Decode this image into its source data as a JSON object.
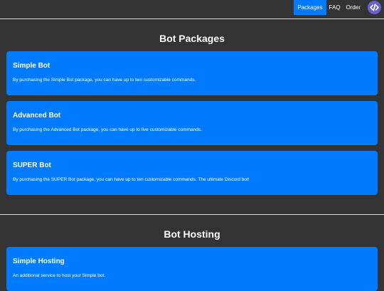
{
  "nav": {
    "links": [
      {
        "label": "Packages",
        "active": true
      },
      {
        "label": "FAQ",
        "active": false
      },
      {
        "label": "Order",
        "active": false
      }
    ],
    "logo_icon": "code-brackets-icon"
  },
  "packages": {
    "heading": "Bot Packages",
    "cards": [
      {
        "title": "Simple Bot",
        "text": "By purchasing the Simple Bot package, you can have up to two customizable commands."
      },
      {
        "title": "Advanced Bot",
        "text": "By purchasing the Advanced Bot package, you can have up to five customizable commands."
      },
      {
        "title": "SUPER Bot",
        "text": "By purchasing the SUPER Bot package, you can have up to ten customizable commands. The ultimate Discord bot!"
      }
    ]
  },
  "hosting": {
    "heading": "Bot Hosting",
    "cards": [
      {
        "title": "Simple Hosting",
        "text": "An additional service to host your Simple bot."
      }
    ]
  },
  "colors": {
    "background": "#333333",
    "accent": "#007bff",
    "logo": "#6b5fd0",
    "divider": "#d8d8d8"
  }
}
